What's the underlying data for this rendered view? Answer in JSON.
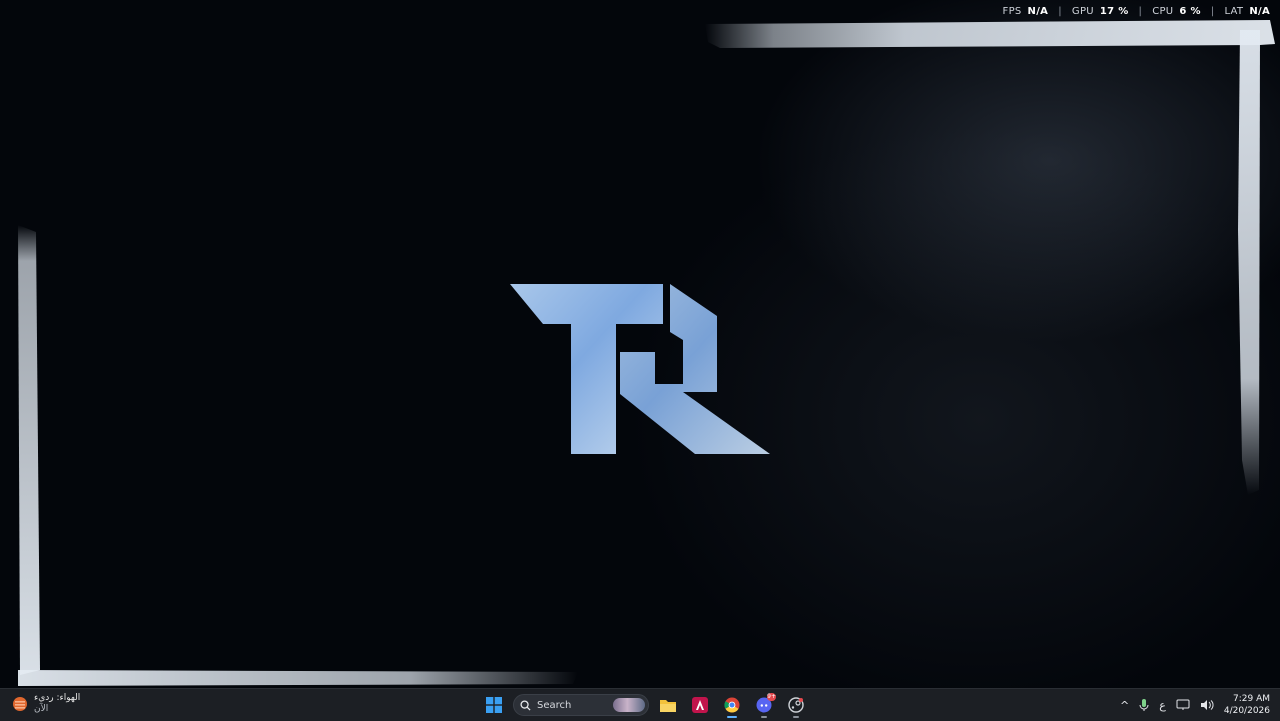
{
  "perf_overlay": {
    "fps_label": "FPS",
    "fps_value": "N/A",
    "gpu_label": "GPU",
    "gpu_value": "17 %",
    "cpu_label": "CPU",
    "cpu_value": "6 %",
    "lat_label": "LAT",
    "lat_value": "N/A",
    "separator": "|"
  },
  "wallpaper": {
    "logo_text": "TR",
    "logo_color": "#8fb6e6",
    "frame_color": "#dfe7f0"
  },
  "taskbar": {
    "weather": {
      "title": "الهواء: رديء",
      "subtitle": "الآن",
      "icon": "weather-icon"
    },
    "search_placeholder": "Search",
    "apps": [
      {
        "name": "start-button",
        "icon": "windows-icon"
      },
      {
        "name": "file-explorer-button",
        "icon": "folder-icon"
      },
      {
        "name": "affinity-button",
        "icon": "affinity-icon"
      },
      {
        "name": "chrome-button",
        "icon": "chrome-icon"
      },
      {
        "name": "discord-button",
        "icon": "discord-icon",
        "badge": "9+"
      },
      {
        "name": "steam-button",
        "icon": "steam-icon"
      }
    ],
    "tray": {
      "chevron": "^",
      "language": "ع",
      "time": "7:29 AM",
      "date": "4/20/2026"
    }
  }
}
